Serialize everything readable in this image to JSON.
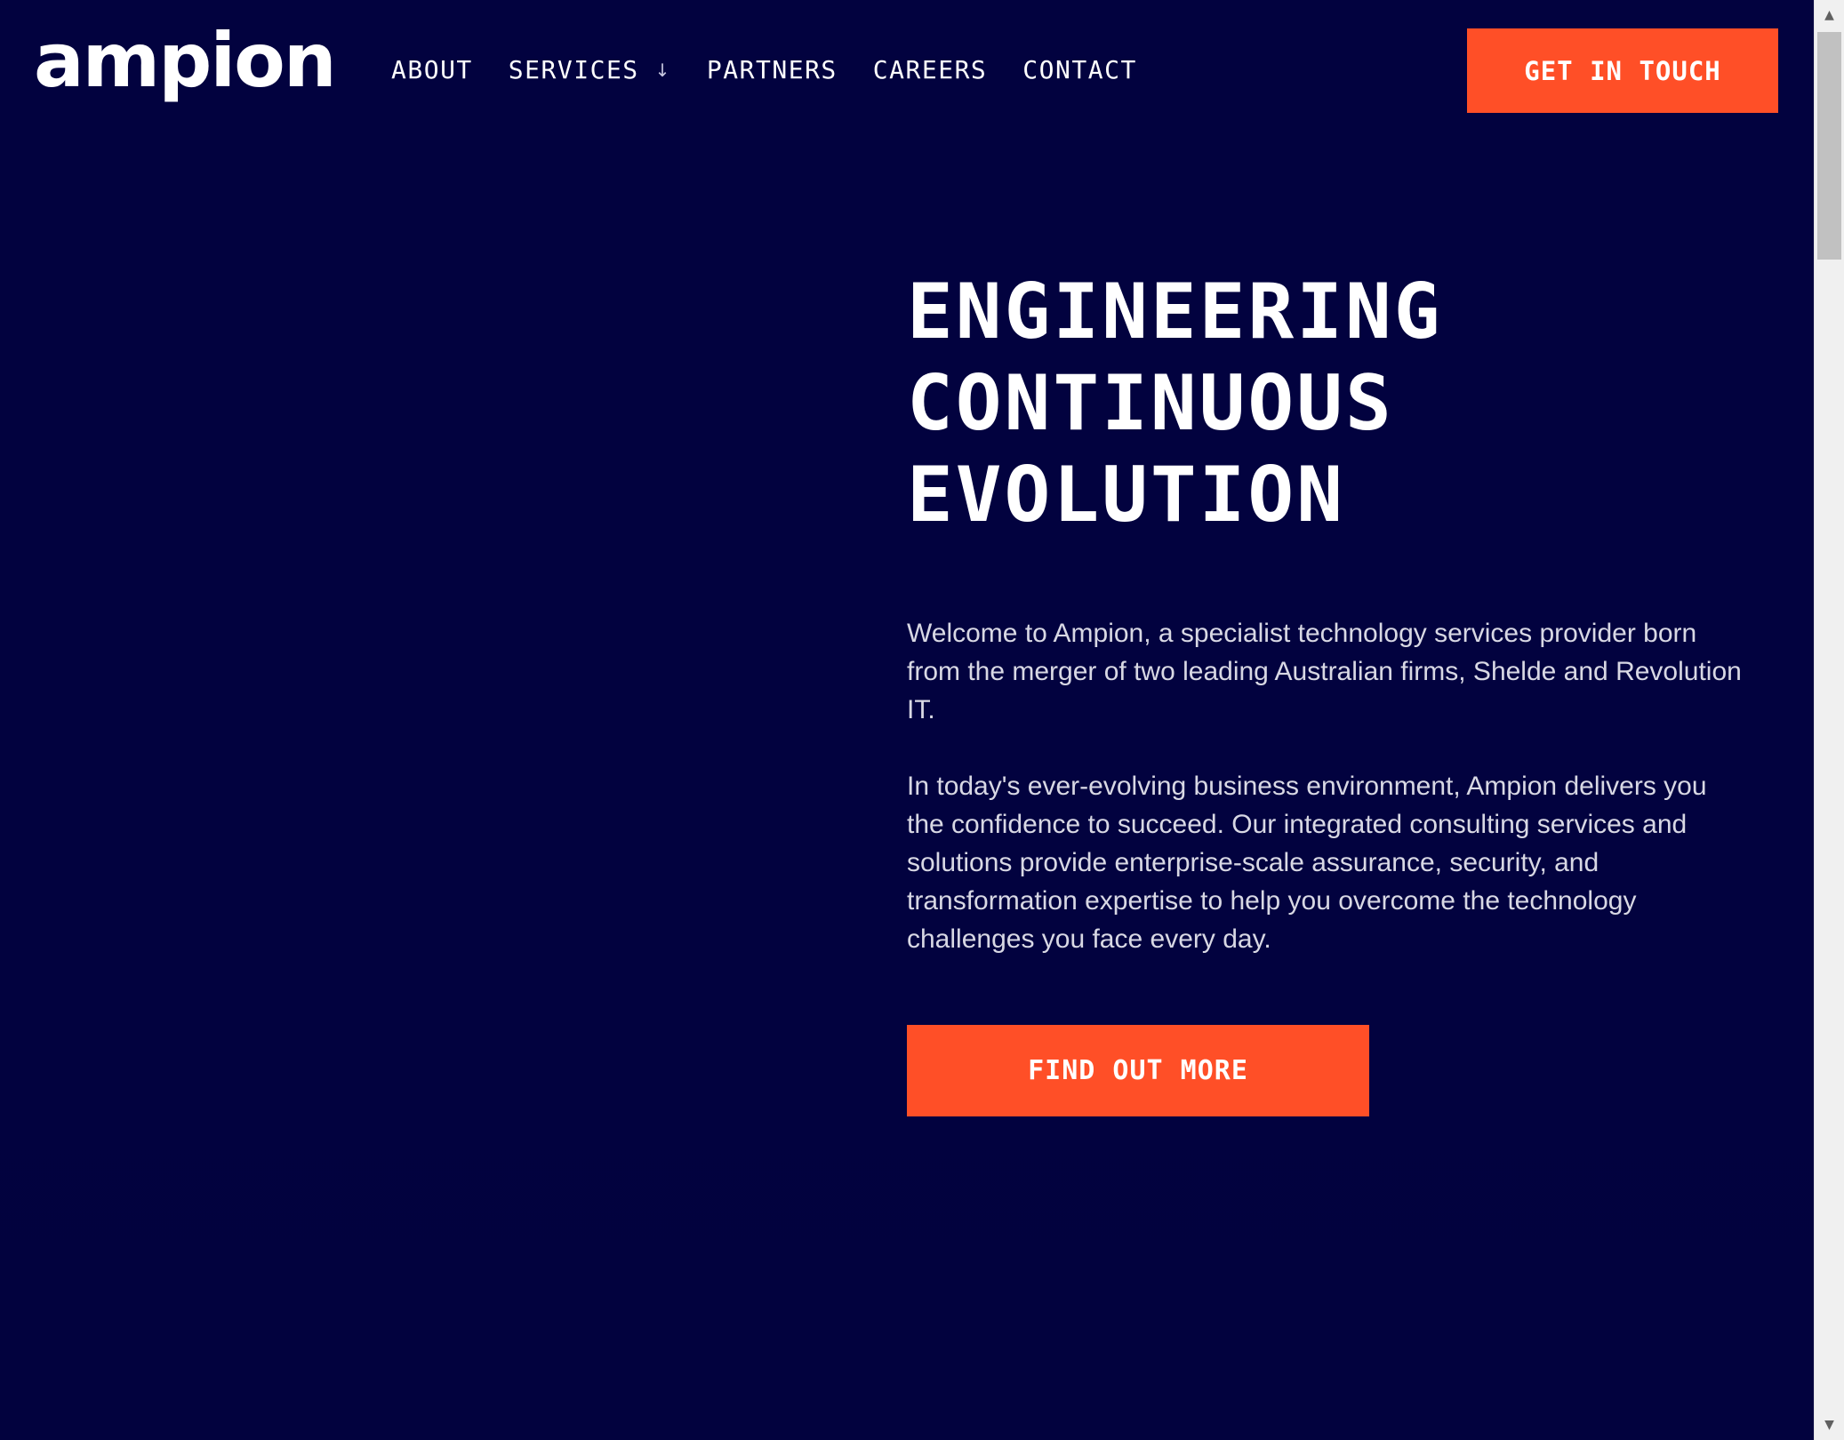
{
  "header": {
    "logo_text": "ampion",
    "nav": [
      {
        "label": "ABOUT"
      },
      {
        "label": "SERVICES",
        "arrow": "↓"
      },
      {
        "label": "PARTNERS"
      },
      {
        "label": "CAREERS"
      },
      {
        "label": "CONTACT"
      }
    ],
    "cta_label": "GET IN TOUCH"
  },
  "hero": {
    "title_lines": [
      "ENGINEERING",
      "CONTINUOUS",
      "EVOLUTION"
    ],
    "paragraph_1": "Welcome to Ampion, a specialist technology services provider born from the merger of two leading Australian firms, Shelde and Revolution IT.",
    "paragraph_2": "In today's ever-evolving business environment, Ampion delivers you the confidence to succeed. Our integrated consulting services and solutions provide enterprise-scale assurance, security, and transformation expertise to help you overcome the technology challenges you face every day.",
    "cta_label": "FIND OUT MORE"
  },
  "scrollbar": {
    "up_arrow": "▲",
    "down_arrow": "▼"
  },
  "colors": {
    "background": "#02023f",
    "accent": "#ff4f27",
    "text": "#ffffff"
  }
}
